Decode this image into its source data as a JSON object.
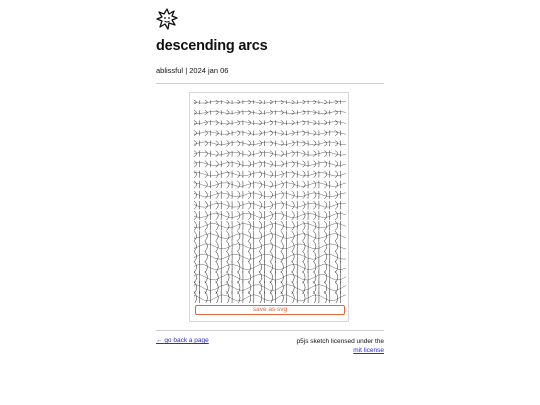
{
  "header": {
    "logo_icon": "starburst-face-icon",
    "title": "descending arcs",
    "author": "ablissful",
    "separator": "|",
    "date": "2024 jan 06"
  },
  "artwork": {
    "stroke_color": "#222222",
    "save_label": "save as svg",
    "save_color": "#e2663a"
  },
  "footer": {
    "back_arrow": "←",
    "back_label": "go back a page",
    "license_text": "p5js sketch licensed under the",
    "license_link": "mit license",
    "link_color": "#2a2ad0"
  }
}
